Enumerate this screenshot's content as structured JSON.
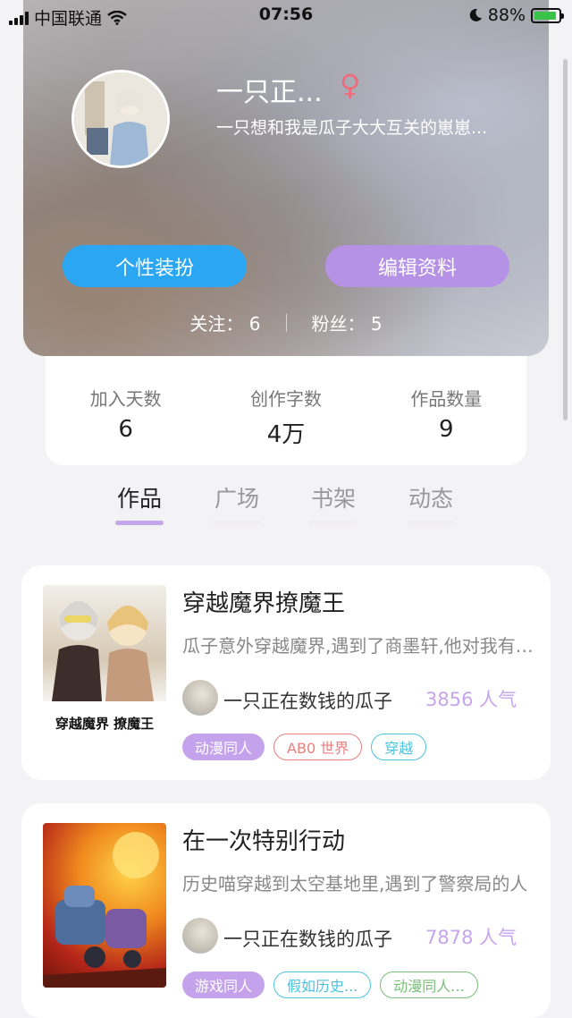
{
  "status_bar": {
    "carrier": "中国联通",
    "time": "07:56",
    "battery": "88%"
  },
  "profile": {
    "nickname": "一只正...",
    "gender_symbol": "♀",
    "bio": "一只想和我是瓜子大大互关的崽崽...",
    "decorate_button": "个性装扮",
    "edit_button": "编辑资料",
    "following_label": "关注：",
    "following_count": "6",
    "followers_label": "粉丝：",
    "followers_count": "5"
  },
  "stats": [
    {
      "label": "加入天数",
      "value": "6"
    },
    {
      "label": "创作字数",
      "value": "4万"
    },
    {
      "label": "作品数量",
      "value": "9"
    }
  ],
  "tabs": [
    {
      "label": "作品",
      "active": true
    },
    {
      "label": "广场",
      "active": false
    },
    {
      "label": "书架",
      "active": false
    },
    {
      "label": "动态",
      "active": false
    }
  ],
  "books": [
    {
      "title": "穿越魔界撩魔王",
      "description": "瓜子意外穿越魔界,遇到了商墨轩,他对我有意思",
      "author": "一只正在数钱的瓜子",
      "popularity": "3856 人气",
      "cover_text": "穿越魔界 撩魔王",
      "tags": [
        {
          "label": "动漫同人",
          "style": "purple"
        },
        {
          "label": "AB0 世界",
          "style": "red"
        },
        {
          "label": "穿越",
          "style": "cyan"
        }
      ]
    },
    {
      "title": "在一次特别行动",
      "description": "历史喵穿越到太空基地里,遇到了警察局的人",
      "author": "一只正在数钱的瓜子",
      "popularity": "7878 人气",
      "tags": [
        {
          "label": "游戏同人",
          "style": "purple"
        },
        {
          "label": "假如历史...",
          "style": "cyan"
        },
        {
          "label": "动漫同人...",
          "style": "green"
        }
      ]
    }
  ],
  "colors": {
    "accent_blue": "#2aa6f3",
    "accent_purple": "#b692e6",
    "popularity": "#c7a4ee"
  }
}
